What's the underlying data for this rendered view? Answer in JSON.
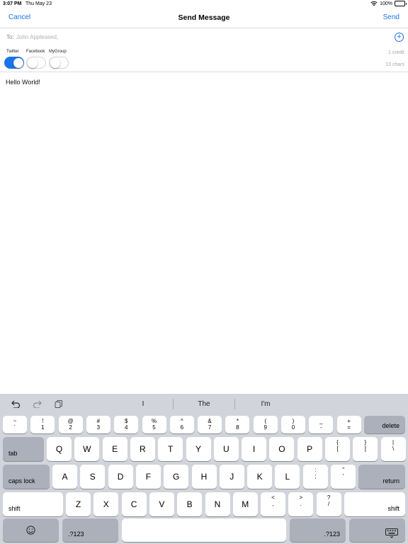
{
  "status_bar": {
    "time": "3:07 PM",
    "date": "Thu May 23",
    "battery_text": "100%",
    "battery_level": 1.0
  },
  "nav": {
    "cancel_label": "Cancel",
    "title": "Send Message",
    "send_label": "Send"
  },
  "to_field": {
    "label": "To:",
    "value": "John Appleseed,"
  },
  "services": [
    {
      "label": "Twitter",
      "on": true
    },
    {
      "label": "Facebook",
      "on": false
    },
    {
      "label": "MyGroup",
      "on": false
    }
  ],
  "credit_text": "1 credit",
  "chars_text": "13 chars",
  "message": {
    "body": "Hello World!"
  },
  "keyboard": {
    "suggestions": [
      "I",
      "The",
      "I'm"
    ],
    "number_row": [
      {
        "top": "~",
        "bottom": "`"
      },
      {
        "top": "!",
        "bottom": "1"
      },
      {
        "top": "@",
        "bottom": "2"
      },
      {
        "top": "#",
        "bottom": "3"
      },
      {
        "top": "$",
        "bottom": "4"
      },
      {
        "top": "%",
        "bottom": "5"
      },
      {
        "top": "^",
        "bottom": "6"
      },
      {
        "top": "&",
        "bottom": "7"
      },
      {
        "top": "*",
        "bottom": "8"
      },
      {
        "top": "(",
        "bottom": "9"
      },
      {
        "top": ")",
        "bottom": "0"
      },
      {
        "top": "_",
        "bottom": "-"
      },
      {
        "top": "+",
        "bottom": "="
      }
    ],
    "delete_label": "delete",
    "tab_label": "tab",
    "qwerty_row": [
      "Q",
      "W",
      "E",
      "R",
      "T",
      "Y",
      "U",
      "I",
      "O",
      "P"
    ],
    "qwerty_extra": [
      {
        "top": "{",
        "bottom": "["
      },
      {
        "top": "}",
        "bottom": "]"
      },
      {
        "top": "|",
        "bottom": "\\"
      }
    ],
    "caps_label": "caps lock",
    "home_row": [
      "A",
      "S",
      "D",
      "F",
      "G",
      "H",
      "J",
      "K",
      "L"
    ],
    "home_extra": [
      {
        "top": ":",
        "bottom": ";"
      },
      {
        "top": "\"",
        "bottom": "'"
      }
    ],
    "return_label": "return",
    "shift_label": "shift",
    "bottom_row": [
      "Z",
      "X",
      "C",
      "V",
      "B",
      "N",
      "M"
    ],
    "bottom_extra": [
      {
        "top": "<",
        "bottom": ","
      },
      {
        "top": ">",
        "bottom": "."
      },
      {
        "top": "?",
        "bottom": "/"
      }
    ],
    "numbers_label": ".?123"
  },
  "colors": {
    "accent": "#1a73e8",
    "keyboard_bg": "#d1d4da",
    "dark_key": "#abb0bb"
  }
}
